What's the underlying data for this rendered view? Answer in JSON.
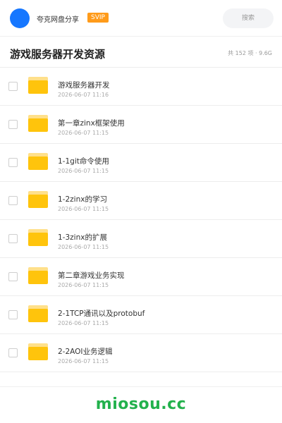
{
  "header": {
    "username": "夸克网盘分享",
    "badge": "SVIP",
    "search_placeholder": "搜索",
    "avatar_color": "#1677ff"
  },
  "page": {
    "title": "游戏服务器开发资源",
    "meta": "共 152 项 · 9.6G"
  },
  "files": [
    {
      "name": "游戏服务器开发",
      "date": "2026-06-07 11:16",
      "icon": "folder-icon"
    },
    {
      "name": "第一章zinx框架使用",
      "date": "2026-06-07 11:15",
      "icon": "folder-icon"
    },
    {
      "name": "1-1git命令使用",
      "date": "2026-06-07 11:15",
      "icon": "folder-icon"
    },
    {
      "name": "1-2zinx的学习",
      "date": "2026-06-07 11:15",
      "icon": "folder-icon"
    },
    {
      "name": "1-3zinx的扩展",
      "date": "2026-06-07 11:15",
      "icon": "folder-icon"
    },
    {
      "name": "第二章游戏业务实现",
      "date": "2026-06-07 11:15",
      "icon": "folder-icon"
    },
    {
      "name": "2-1TCP通讯以及protobuf",
      "date": "2026-06-07 11:15",
      "icon": "folder-icon"
    },
    {
      "name": "2-2AOI业务逻辑",
      "date": "2026-06-07 11:15",
      "icon": "folder-icon"
    }
  ],
  "footer": {
    "watermark": "miosou.cc",
    "watermark_color": "#22b14c"
  }
}
